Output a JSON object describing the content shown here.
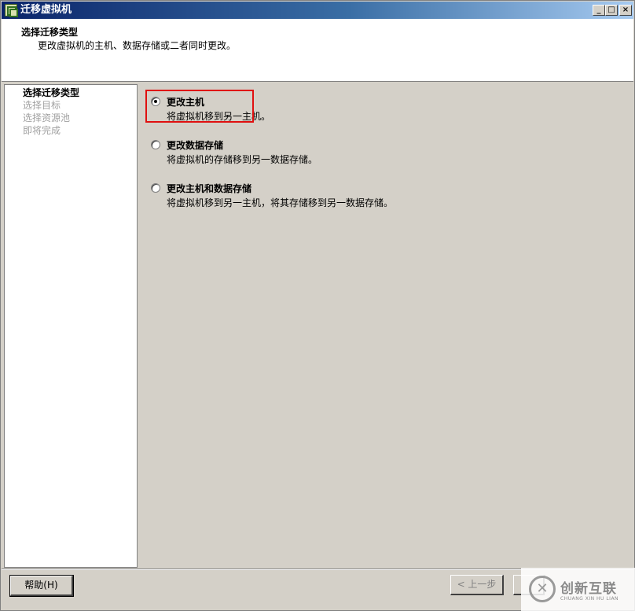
{
  "window": {
    "title": "迁移虚拟机",
    "controls": {
      "minimize": "_",
      "maximize": "□",
      "close": "×"
    }
  },
  "header": {
    "title": "选择迁移类型",
    "description": "更改虚拟机的主机、数据存储或二者同时更改。"
  },
  "steps": [
    {
      "label": "选择迁移类型",
      "active": true
    },
    {
      "label": "选择目标",
      "active": false
    },
    {
      "label": "选择资源池",
      "active": false
    },
    {
      "label": "即将完成",
      "active": false
    }
  ],
  "options": [
    {
      "label": "更改主机",
      "description": "将虚拟机移到另一主机。",
      "selected": true
    },
    {
      "label": "更改数据存储",
      "description": "将虚拟机的存储移到另一数据存储。",
      "selected": false
    },
    {
      "label": "更改主机和数据存储",
      "description": "将虚拟机移到另一主机，将其存储移到另一数据存储。",
      "selected": false
    }
  ],
  "footer": {
    "help": "帮助(H)",
    "back": "< 上一步",
    "next": ""
  },
  "watermark": {
    "logo_mark": "✕",
    "text": "创新互联",
    "subtext": "CHUANG XIN HU LIAN"
  },
  "colors": {
    "highlight_border": "#e01010",
    "titlebar_start": "#0a246a",
    "titlebar_end": "#a6caf0",
    "disabled_text": "#a0a0a0"
  }
}
